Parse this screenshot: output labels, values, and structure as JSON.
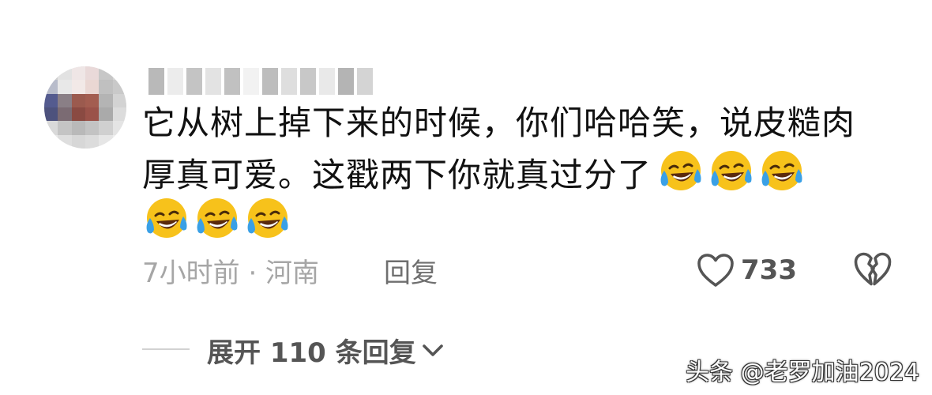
{
  "comment": {
    "text": "它从树上掉下来的时候，你们哈哈笑，说皮糙肉厚真可爱。这戳两下你就真过分了",
    "emoji_name": "laughing-crying-emoji",
    "emoji_count_inline": 3,
    "emoji_count_next_line": 3
  },
  "meta": {
    "time_location": "7小时前 · 河南",
    "reply_label": "回复"
  },
  "likes": {
    "count": "733"
  },
  "expand": {
    "label": "展开 110 条回复"
  },
  "watermark": {
    "text": "头条 @老罗加油2024"
  },
  "colors": {
    "text_primary": "#111111",
    "text_secondary": "#a6a6a6",
    "reply": "#6f6f6f",
    "emoji_face": "#f7c21b",
    "emoji_tear": "#3aa0e6"
  }
}
